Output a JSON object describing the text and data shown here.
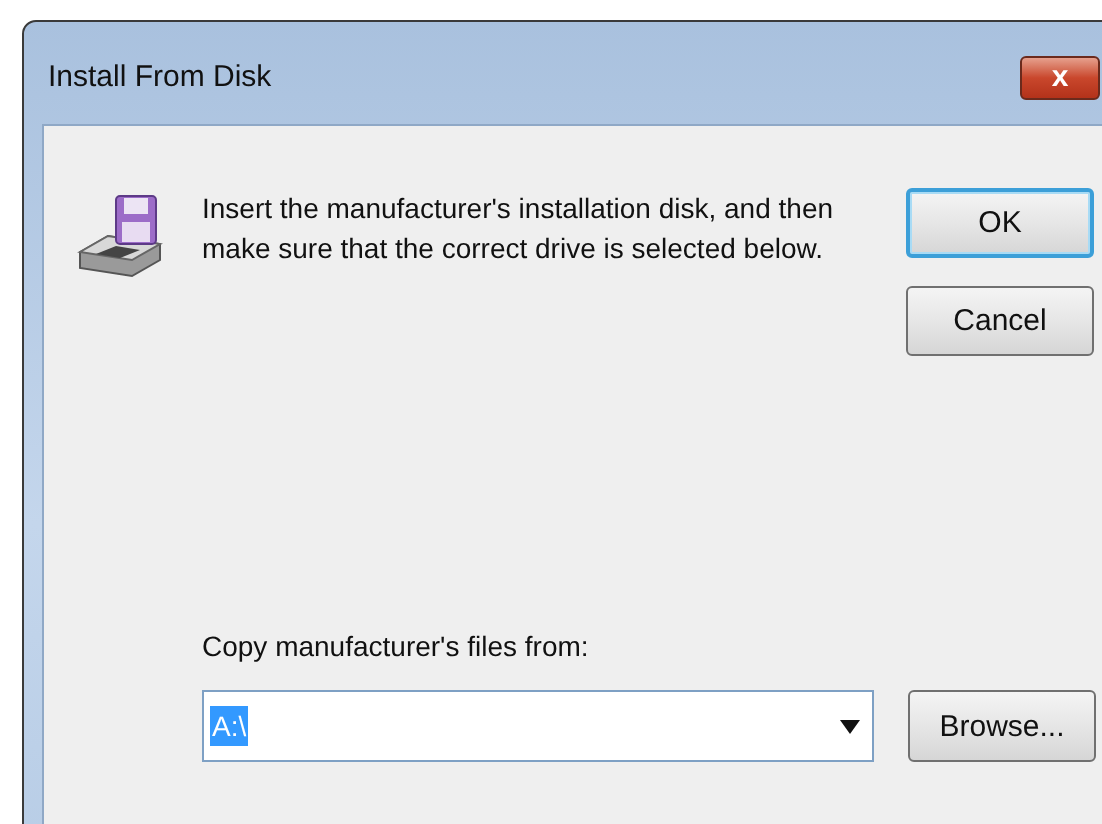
{
  "window": {
    "title": "Install From Disk",
    "close_label": "x"
  },
  "message": "Insert the manufacturer's installation disk, and then make sure that the correct drive is selected below.",
  "buttons": [
    {
      "label": "OK",
      "default": true
    },
    {
      "label": "Cancel",
      "default": false
    }
  ],
  "copy_from": {
    "label": "Copy manufacturer's files from:",
    "value": "A:\\",
    "selected": true
  },
  "browse_button": {
    "label": "Browse..."
  }
}
